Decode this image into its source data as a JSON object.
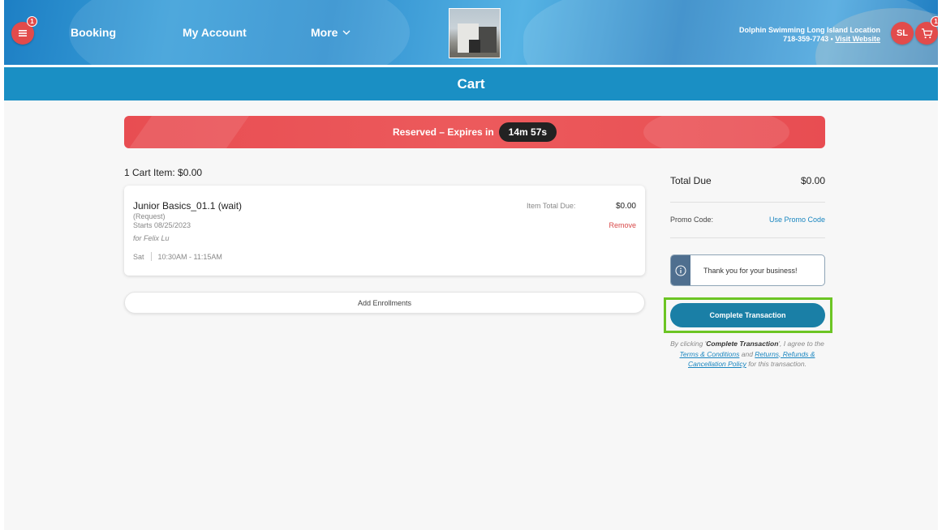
{
  "header": {
    "menu_badge": "1",
    "nav": {
      "booking": "Booking",
      "my_account": "My Account",
      "more": "More"
    },
    "location": {
      "name": "Dolphin Swimming Long Island Location",
      "phone": "718-359-7743",
      "separator": "•",
      "visit": "Visit Website"
    },
    "user_initials": "SL",
    "cart_badge": "1"
  },
  "page_title": "Cart",
  "reservation": {
    "label": "Reserved – Expires in",
    "timer": "14m 57s"
  },
  "cart": {
    "summary": "1 Cart Item: $0.00",
    "items": [
      {
        "name": "Junior Basics_01.1 (wait)",
        "type": "(Request)",
        "starts": "Starts 08/25/2023",
        "for": "for Felix Lu",
        "day": "Sat",
        "time": "10:30AM - 11:15AM",
        "total_label": "Item Total Due:",
        "total_value": "$0.00",
        "remove_label": "Remove"
      }
    ],
    "add_enrollments": "Add Enrollments"
  },
  "summary": {
    "total_label": "Total Due",
    "total_value": "$0.00",
    "promo_label": "Promo Code:",
    "promo_link": "Use Promo Code",
    "info_message": "Thank you for your business!",
    "complete_button": "Complete Transaction",
    "agree": {
      "pre": "By clicking '",
      "button_ref": "Complete Transaction",
      "mid": "', I agree to the",
      "terms": "Terms & Conditions",
      "and": " and ",
      "policy": "Returns, Refunds & Cancellation Policy",
      "post": " for this transaction."
    }
  },
  "colors": {
    "header_blue": "#1a8fc4",
    "alert_red": "#e84d52",
    "action_button": "#1a7fa6",
    "highlight_green": "#6cc524",
    "link": "#1a86c0"
  }
}
